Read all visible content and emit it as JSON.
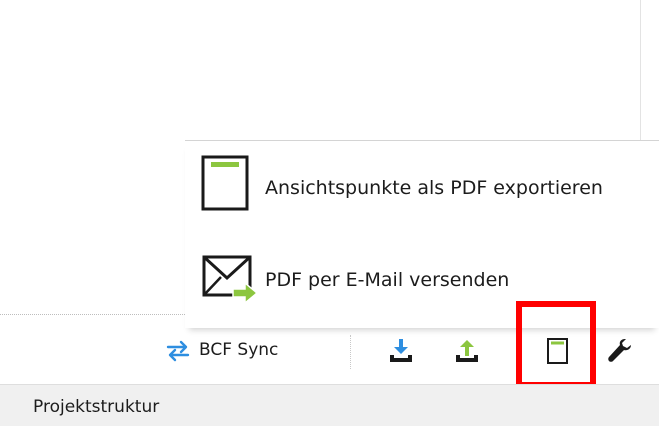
{
  "export_menu": {
    "items": [
      {
        "label": "Ansichtspunkte als PDF exportieren",
        "icon": "pdf-document-icon"
      },
      {
        "label": "PDF per E-Mail versenden",
        "icon": "email-send-icon"
      }
    ]
  },
  "toolbar": {
    "bcf_sync_label": "BCF Sync",
    "bcf_sync_icon": "sync-arrows-icon",
    "buttons": [
      {
        "icon": "download-icon"
      },
      {
        "icon": "upload-icon"
      },
      {
        "icon": "pdf-export-icon",
        "highlighted": true
      },
      {
        "icon": "wrench-icon"
      }
    ]
  },
  "panel": {
    "title": "Projektstruktur"
  },
  "colors": {
    "accent_green": "#8cc63f",
    "sync_blue": "#2e8ee0",
    "highlight_red": "#ff0000",
    "panel_bg": "#f0f0f0"
  }
}
